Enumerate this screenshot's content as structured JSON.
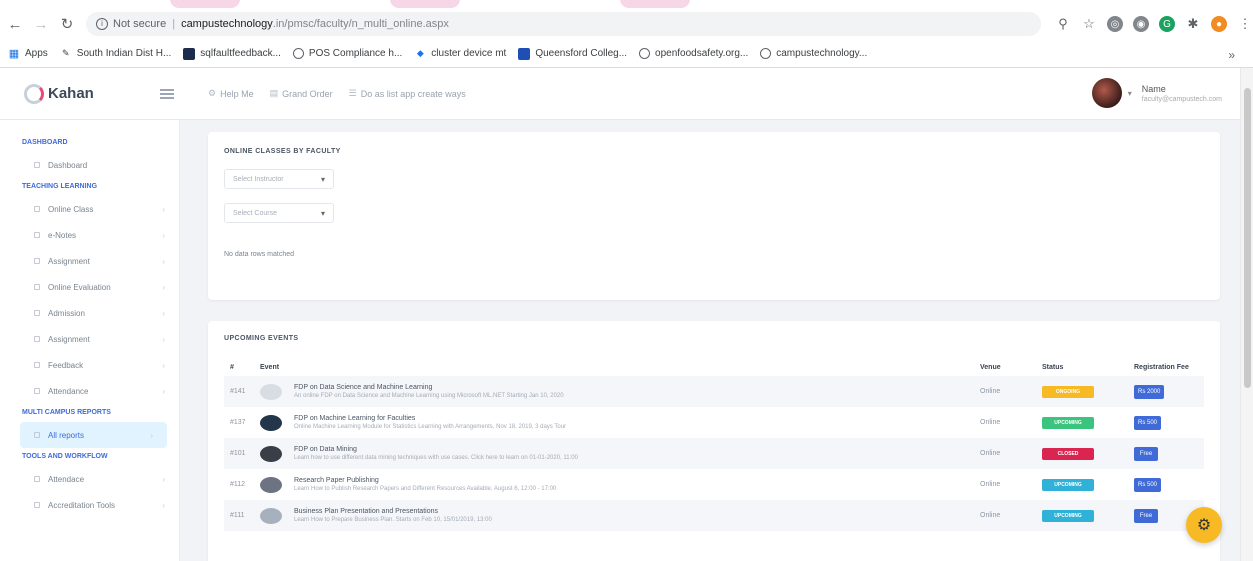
{
  "browser": {
    "url_security": "Not secure",
    "url_host": "campustechnology",
    "url_path": ".in/pmsc/faculty/n_multi_online.aspx",
    "bookmarks": [
      {
        "label": "Apps",
        "icon": "apps-icon"
      },
      {
        "label": "South Indian Dist H...",
        "icon": "bookmark-icon"
      },
      {
        "label": "sqlfaultfeedback...",
        "icon": "page-icon"
      },
      {
        "label": "POS Compliance h...",
        "icon": "globe-icon"
      },
      {
        "label": "cluster device mt",
        "icon": "page-icon"
      },
      {
        "label": "Queensford Colleg...",
        "icon": "page-icon"
      },
      {
        "label": "openfoodsafety.org...",
        "icon": "globe-icon"
      },
      {
        "label": "campustechnology...",
        "icon": "globe-icon"
      }
    ]
  },
  "app": {
    "logo_text": "Kahan",
    "toplinks": [
      "Help Me",
      "Grand Order",
      "Do as list app create ways"
    ],
    "user_name": "Name",
    "user_sub": "faculty@campustech.com"
  },
  "sidebar": {
    "sections": [
      {
        "heading": "DASHBOARD",
        "items": [
          {
            "label": "Dashboard"
          }
        ]
      },
      {
        "heading": "TEACHING LEARNING",
        "items": [
          {
            "label": "Online Class"
          },
          {
            "label": "e-Notes"
          },
          {
            "label": "Assignment"
          },
          {
            "label": "Online Evaluation"
          },
          {
            "label": "Admission"
          },
          {
            "label": "Assignment"
          },
          {
            "label": "Feedback"
          },
          {
            "label": "Attendance"
          }
        ]
      },
      {
        "heading": "MULTI CAMPUS REPORTS",
        "items": [
          {
            "label": "All reports",
            "active": true
          }
        ]
      },
      {
        "heading": "TOOLS AND WORKFLOW",
        "items": [
          {
            "label": "Attendace"
          },
          {
            "label": "Accreditation Tools"
          }
        ]
      }
    ]
  },
  "online_classes": {
    "title": "ONLINE CLASSES BY FACULTY",
    "select1": "Select Instructor",
    "select2": "Select Course",
    "nodata": "No data rows matched"
  },
  "events": {
    "title": "UPCOMING EVENTS",
    "headers": {
      "no": "#",
      "event": "Event",
      "venue": "Venue",
      "status": "Status",
      "fee": "Registration Fee"
    },
    "rows": [
      {
        "no": "#141",
        "title": "FDP on Data Science and Machine Learning",
        "sub": "An online FDP on Data Science and Machine Learning using Microsoft ML.NET Starting Jan 10, 2020",
        "venue": "Online",
        "status": "Ongoing",
        "status_color": "#f7b924",
        "fee": "Rs 2000",
        "thumb_color": "#d8dde3"
      },
      {
        "no": "#137",
        "title": "FDP on Machine Learning for Faculties",
        "sub": "Online Machine Learning Module for Statistics Learning with Arrangements, Nov 18, 2019, 3 days Tour",
        "venue": "Online",
        "status": "Upcoming",
        "status_color": "#3ac47d",
        "fee": "Rs 500",
        "thumb_color": "#23364a"
      },
      {
        "no": "#101",
        "title": "FDP on Data Mining",
        "sub": "Learn how to use different data mining techniques with use cases. Click here to learn on 01-01-2020, 11:00",
        "venue": "Online",
        "status": "Closed",
        "status_color": "#d92550",
        "fee": "Free",
        "thumb_color": "#3a3f47"
      },
      {
        "no": "#112",
        "title": "Research Paper Publishing",
        "sub": "Learn How to Publish Research Papers and Different Resources Available, August 6, 12:00 - 17:00",
        "venue": "Online",
        "status": "Upcoming",
        "status_color": "#30b1d8",
        "fee": "Rs 500",
        "thumb_color": "#6b7480"
      },
      {
        "no": "#111",
        "title": "Business Plan Presentation and Presentations",
        "sub": "Learn How to Prepare Business Plan. Starts on Feb 10, 15/01/2019, 13:00",
        "venue": "Online",
        "status": "Upcoming",
        "status_color": "#30b1d8",
        "fee": "Free",
        "thumb_color": "#a7b1bd"
      }
    ]
  }
}
